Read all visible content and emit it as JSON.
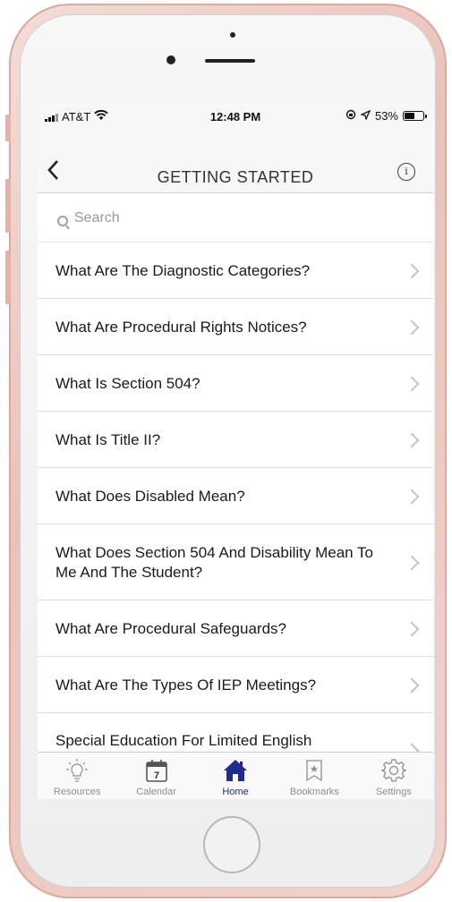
{
  "status_bar": {
    "carrier": "AT&T",
    "time": "12:48 PM",
    "battery": "53%",
    "battery_level": 0.53,
    "icons": [
      "signal-icon",
      "wifi-icon",
      "orientation-lock-icon",
      "location-icon",
      "battery-icon"
    ]
  },
  "nav": {
    "title": "GETTING STARTED",
    "back_icon": "chevron-left-icon",
    "info_icon": "info-icon"
  },
  "search": {
    "placeholder": "Search",
    "icon": "search-icon"
  },
  "list": {
    "items": [
      {
        "label": "What Are The Diagnostic Categories?"
      },
      {
        "label": "What Are Procedural Rights Notices?"
      },
      {
        "label": "What Is Section 504?"
      },
      {
        "label": "What Is Title II?"
      },
      {
        "label": "What Does Disabled Mean?"
      },
      {
        "label": "What Does Section 504 And Disability Mean To Me And The Student?"
      },
      {
        "label": "What Are Procedural Safeguards?"
      },
      {
        "label": "What Are The Types Of IEP Meetings?"
      },
      {
        "label": "Special Education For Limited English"
      }
    ]
  },
  "tabbar": {
    "tabs": [
      {
        "label": "Resources",
        "icon": "lightbulb-icon",
        "active": false
      },
      {
        "label": "Calendar",
        "icon": "calendar-icon",
        "day": "7",
        "active": false
      },
      {
        "label": "Home",
        "icon": "home-icon",
        "active": true
      },
      {
        "label": "Bookmarks",
        "icon": "bookmark-icon",
        "active": false
      },
      {
        "label": "Settings",
        "icon": "gear-icon",
        "active": false
      }
    ]
  },
  "colors": {
    "accent": "#1f2b8f",
    "phone_frame": "#e9c3bb"
  }
}
